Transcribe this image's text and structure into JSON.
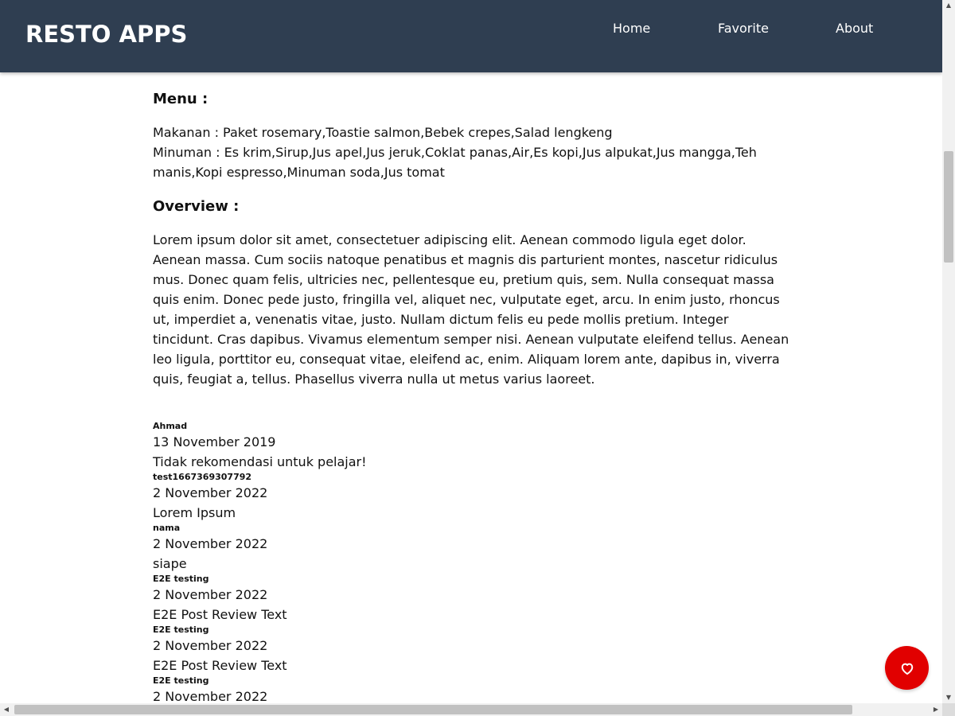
{
  "header": {
    "brand": "RESTO APPS",
    "nav": [
      {
        "label": "Home"
      },
      {
        "label": "Favorite"
      },
      {
        "label": "About"
      }
    ]
  },
  "detail": {
    "menu_heading": "Menu :",
    "foods_line": "Makanan : Paket rosemary,Toastie salmon,Bebek crepes,Salad lengkeng",
    "drinks_line": "Minuman : Es krim,Sirup,Jus apel,Jus jeruk,Coklat panas,Air,Es kopi,Jus alpukat,Jus mangga,Teh manis,Kopi espresso,Minuman soda,Jus tomat",
    "overview_heading": "Overview :",
    "overview_text": "Lorem ipsum dolor sit amet, consectetuer adipiscing elit. Aenean commodo ligula eget dolor. Aenean massa. Cum sociis natoque penatibus et magnis dis parturient montes, nascetur ridiculus mus. Donec quam felis, ultricies nec, pellentesque eu, pretium quis, sem. Nulla consequat massa quis enim. Donec pede justo, fringilla vel, aliquet nec, vulputate eget, arcu. In enim justo, rhoncus ut, imperdiet a, venenatis vitae, justo. Nullam dictum felis eu pede mollis pretium. Integer tincidunt. Cras dapibus. Vivamus elementum semper nisi. Aenean vulputate eleifend tellus. Aenean leo ligula, porttitor eu, consequat vitae, eleifend ac, enim. Aliquam lorem ante, dapibus in, viverra quis, feugiat a, tellus. Phasellus viverra nulla ut metus varius laoreet."
  },
  "reviews": [
    {
      "name": "Ahmad",
      "date": "13 November 2019",
      "text": "Tidak rekomendasi untuk pelajar!"
    },
    {
      "name": "test1667369307792",
      "date": "2 November 2022",
      "text": "Lorem Ipsum"
    },
    {
      "name": "nama",
      "date": "2 November 2022",
      "text": "siape"
    },
    {
      "name": "E2E testing",
      "date": "2 November 2022",
      "text": "E2E Post Review Text"
    },
    {
      "name": "E2E testing",
      "date": "2 November 2022",
      "text": "E2E Post Review Text"
    },
    {
      "name": "E2E testing",
      "date": "2 November 2022",
      "text": ""
    }
  ],
  "colors": {
    "header_bg": "#2f3e51",
    "favorite_button": "#e10000"
  },
  "icons": {
    "favorite": "heart-outline-icon"
  }
}
